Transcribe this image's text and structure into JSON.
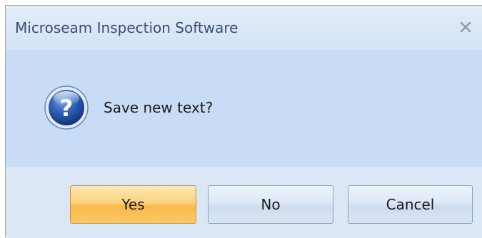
{
  "dialog": {
    "title": "Microseam Inspection Software",
    "message": "Save new text?",
    "icons": {
      "close": "close-icon",
      "message": "question-icon"
    },
    "buttons": {
      "yes": "Yes",
      "no": "No",
      "cancel": "Cancel"
    }
  },
  "colors": {
    "content_background": "#c8dcf5",
    "default_button": "#fbd27d",
    "button": "#dde8f6",
    "icon_blue": "#1f4f9e"
  }
}
